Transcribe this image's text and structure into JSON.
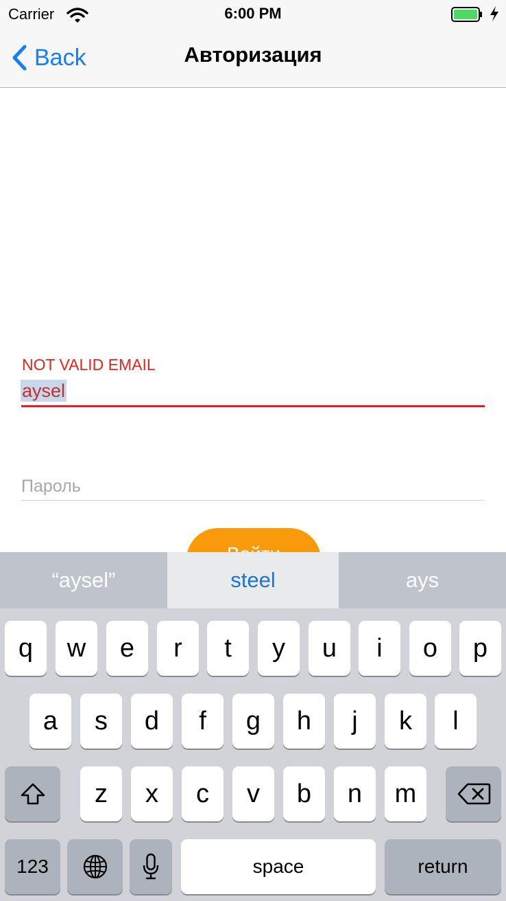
{
  "status_bar": {
    "carrier": "Carrier",
    "time": "6:00 PM",
    "icons": [
      "wifi-icon",
      "battery-icon",
      "charging-bolt-icon"
    ],
    "battery_color": "#4cd964"
  },
  "nav": {
    "back_label": "Back",
    "title": "Авторизация",
    "accent_color": "#147efb"
  },
  "form": {
    "email": {
      "error_label": "NOT VALID EMAIL",
      "value": "aysel",
      "error_color": "#e8231f"
    },
    "password": {
      "placeholder": "Пароль"
    },
    "login_button": {
      "label": "Войти",
      "color": "#f99a0b"
    }
  },
  "keyboard": {
    "suggestions": [
      "“aysel”",
      "steel",
      "ays"
    ],
    "row1": [
      "q",
      "w",
      "e",
      "r",
      "t",
      "y",
      "u",
      "i",
      "o",
      "p"
    ],
    "row2": [
      "a",
      "s",
      "d",
      "f",
      "g",
      "h",
      "j",
      "k",
      "l"
    ],
    "row3": [
      "z",
      "x",
      "c",
      "v",
      "b",
      "n",
      "m"
    ],
    "numbers_label": "123",
    "space_label": "space",
    "return_label": "return",
    "icons": [
      "shift-icon",
      "backspace-icon",
      "globe-icon",
      "microphone-icon"
    ]
  }
}
